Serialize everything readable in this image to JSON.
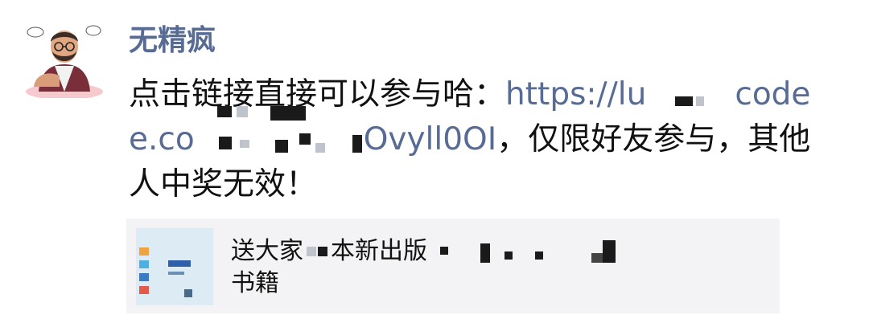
{
  "post": {
    "author_name": "无精疯",
    "avatar_icon": "cartoon-avatar",
    "message": {
      "line1_text": "点击链接直接可以参与哈：",
      "line1_link": "https://lu",
      "line1_link_end": "code",
      "line2_link_start": "e.co",
      "line2_link_end": "Ovyll0OI",
      "line2_text": "，仅限好友参与，其他",
      "line3_text": "人中奖无效！"
    },
    "link_color": "#576b95",
    "name_color": "#576b95"
  },
  "share_card": {
    "title_part1": "送大家",
    "title_part2": "本新出版",
    "title_line2": "书籍",
    "background": "#f3f3f5"
  }
}
